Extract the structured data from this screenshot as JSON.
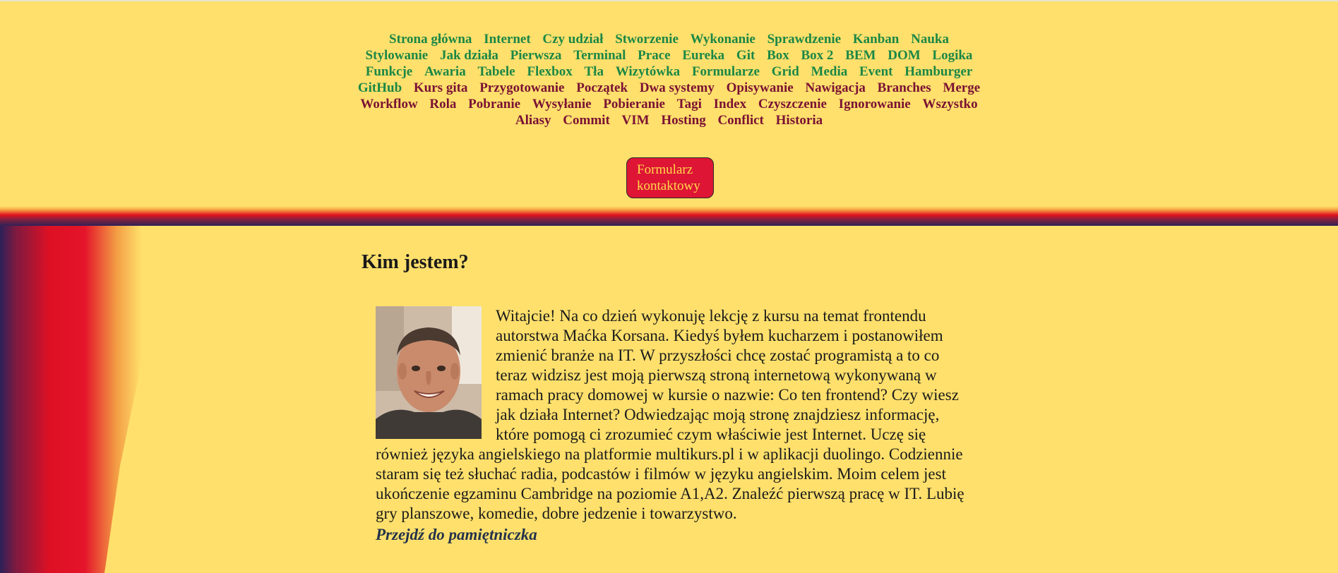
{
  "nav": {
    "items": [
      {
        "label": "Strona główna",
        "color": "#1b8745"
      },
      {
        "label": "Internet",
        "color": "#1b8745"
      },
      {
        "label": "Czy udział",
        "color": "#1b8745"
      },
      {
        "label": "Stworzenie",
        "color": "#1b8745"
      },
      {
        "label": "Wykonanie",
        "color": "#1b8745"
      },
      {
        "label": "Sprawdzenie",
        "color": "#1b8745"
      },
      {
        "label": "Kanban",
        "color": "#1b8745"
      },
      {
        "label": "Nauka",
        "color": "#1b8745"
      },
      {
        "label": "Stylowanie",
        "color": "#1b8745"
      },
      {
        "label": "Jak działa",
        "color": "#1b8745"
      },
      {
        "label": "Pierwsza",
        "color": "#1b8745"
      },
      {
        "label": "Terminal",
        "color": "#1b8745"
      },
      {
        "label": "Prace",
        "color": "#1b8745"
      },
      {
        "label": "Eureka",
        "color": "#1b8745"
      },
      {
        "label": "Git",
        "color": "#1b8745"
      },
      {
        "label": "Box",
        "color": "#1b8745"
      },
      {
        "label": "Box 2",
        "color": "#1b8745"
      },
      {
        "label": "BEM",
        "color": "#1b8745"
      },
      {
        "label": "DOM",
        "color": "#1b8745"
      },
      {
        "label": "Logika",
        "color": "#1b8745"
      },
      {
        "label": "Funkcje",
        "color": "#1b8745"
      },
      {
        "label": "Awaria",
        "color": "#1b8745"
      },
      {
        "label": "Tabele",
        "color": "#1b8745"
      },
      {
        "label": "Flexbox",
        "color": "#1b8745"
      },
      {
        "label": "Tła",
        "color": "#1b8745"
      },
      {
        "label": "Wizytówka",
        "color": "#1b8745"
      },
      {
        "label": "Formularze",
        "color": "#1b8745"
      },
      {
        "label": "Grid",
        "color": "#1b8745"
      },
      {
        "label": "Media",
        "color": "#1b8745"
      },
      {
        "label": "Event",
        "color": "#1b8745"
      },
      {
        "label": "Hamburger",
        "color": "#1b8745"
      },
      {
        "label": "GitHub",
        "color": "#1b8745"
      },
      {
        "label": "Kurs gita",
        "color": "#7a1133"
      },
      {
        "label": "Przygotowanie",
        "color": "#7a1133"
      },
      {
        "label": "Początek",
        "color": "#7a1133"
      },
      {
        "label": "Dwa systemy",
        "color": "#7a1133"
      },
      {
        "label": "Opisywanie",
        "color": "#7a1133"
      },
      {
        "label": "Nawigacja",
        "color": "#7a1133"
      },
      {
        "label": "Branches",
        "color": "#7a1133"
      },
      {
        "label": "Merge",
        "color": "#7a1133"
      },
      {
        "label": "Workflow",
        "color": "#7a1133"
      },
      {
        "label": "Rola",
        "color": "#7a1133"
      },
      {
        "label": "Pobranie",
        "color": "#7a1133"
      },
      {
        "label": "Wysyłanie",
        "color": "#7a1133"
      },
      {
        "label": "Pobieranie",
        "color": "#7a1133"
      },
      {
        "label": "Tagi",
        "color": "#7a1133"
      },
      {
        "label": "Index",
        "color": "#7a1133"
      },
      {
        "label": "Czyszczenie",
        "color": "#7a1133"
      },
      {
        "label": "Ignorowanie",
        "color": "#7a1133"
      },
      {
        "label": "Wszystko",
        "color": "#7a1133"
      },
      {
        "label": "Aliasy",
        "color": "#7a1133"
      },
      {
        "label": "Commit",
        "color": "#7a1133"
      },
      {
        "label": "VIM",
        "color": "#7a1133"
      },
      {
        "label": "Hosting",
        "color": "#7a1133"
      },
      {
        "label": "Conflict",
        "color": "#7a1133"
      },
      {
        "label": "Historia",
        "color": "#7a1133"
      }
    ]
  },
  "contact_button": {
    "label": "Formularz kontaktowy"
  },
  "main": {
    "title": "Kim jestem?",
    "paragraph": "Witajcie! Na co dzień wykonuję lekcję z kursu na temat frontendu autorstwa Maćka Korsana. Kiedyś byłem kucharzem i postanowiłem zmienić branże na IT. W przyszłości chcę zostać programistą a to co teraz widzisz jest moją pierwszą stroną internetową wykonywaną w ramach pracy domowej w kursie o nazwie: Co ten frontend? Czy wiesz jak działa Internet? Odwiedzając moją stronę znajdziesz informację, które pomogą ci zrozumieć czym właściwie jest Internet. Uczę się również języka angielskiego na platformie multikurs.pl i w aplikacji duolingo. Codziennie staram się też słuchać radia, podcastów i filmów w języku angielskim. Moim celem jest ukończenie egzaminu Cambridge na poziomie A1,A2. Znaleźć pierwszą pracę w IT. Lubię gry planszowe, komedie, dobre jedzenie i towarzystwo.",
    "diary_link": "Przejdź do pamiętniczka"
  },
  "colors": {
    "background": "#ffe06c",
    "nav_green": "#1b8745",
    "nav_maroon": "#7a1133",
    "button_red": "#de1534",
    "button_text": "#ffd94a",
    "link_navy": "#23324a"
  }
}
